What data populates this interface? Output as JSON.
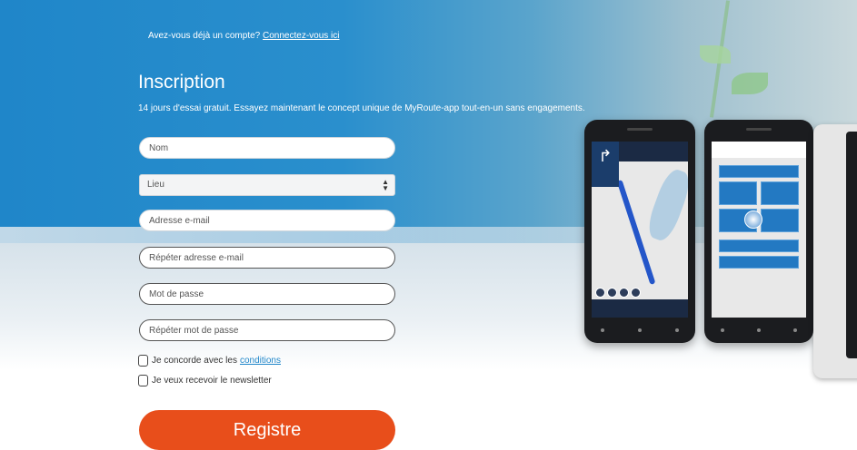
{
  "header": {
    "login_prompt": "Avez-vous déjà un compte?",
    "login_link": "Connectez-vous ici",
    "title": "Inscription",
    "subtitle": "14 jours d'essai gratuit. Essayez maintenant le concept unique de MyRoute-app tout-en-un sans engagements."
  },
  "form": {
    "name_placeholder": "Nom",
    "location_value": "Lieu",
    "email_placeholder": "Adresse e-mail",
    "email_repeat_placeholder": "Répéter adresse e-mail",
    "password_placeholder": "Mot de passe",
    "password_repeat_placeholder": "Répéter mot de passe",
    "terms_text": "Je concorde avec les",
    "terms_link": "conditions",
    "newsletter_text": "Je veux recevoir le newsletter",
    "register_label": "Registre"
  },
  "colors": {
    "brand_blue": "#1f86c9",
    "register_orange": "#e84e1b"
  }
}
